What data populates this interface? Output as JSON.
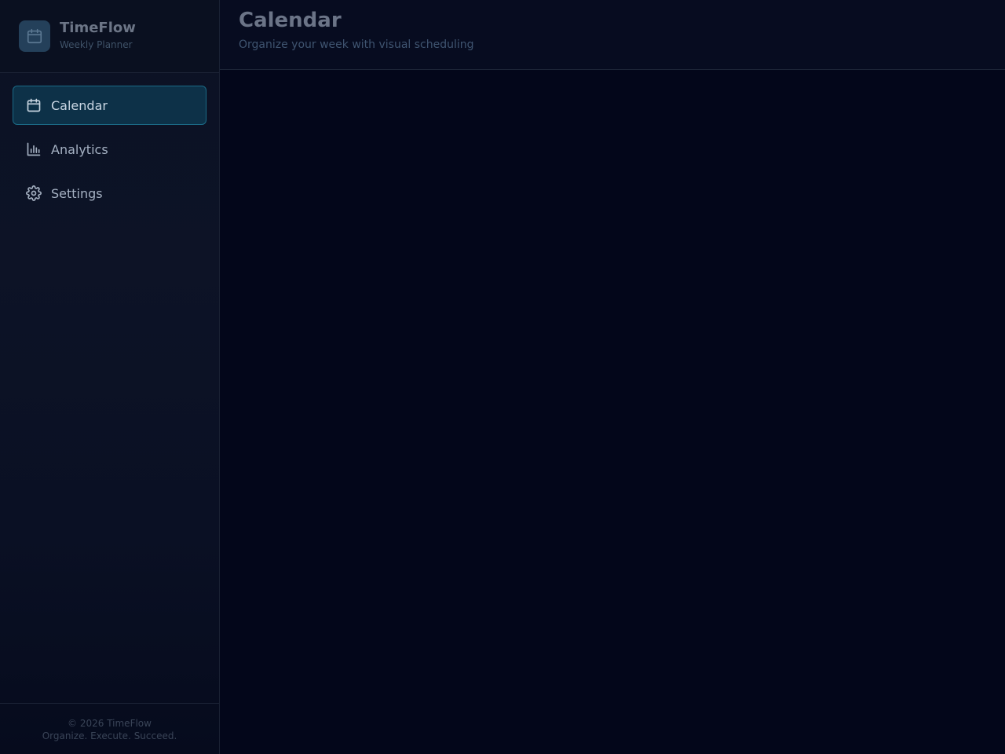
{
  "brand": {
    "title": "TimeFlow",
    "subtitle": "Weekly Planner",
    "logo_icon": "calendar-icon"
  },
  "sidebar": {
    "items": [
      {
        "label": "Calendar",
        "icon": "calendar-icon",
        "active": true
      },
      {
        "label": "Analytics",
        "icon": "bar-chart-icon",
        "active": false
      },
      {
        "label": "Settings",
        "icon": "gear-icon",
        "active": false
      }
    ],
    "footer": {
      "line1": "© 2026 TimeFlow",
      "line2": "Organize. Execute. Succeed."
    }
  },
  "header": {
    "title": "Calendar",
    "subtitle": "Organize your week with visual scheduling"
  },
  "colors": {
    "accent": "#1b6a86",
    "active_bg": "#0d3148",
    "background": "#03061a"
  }
}
